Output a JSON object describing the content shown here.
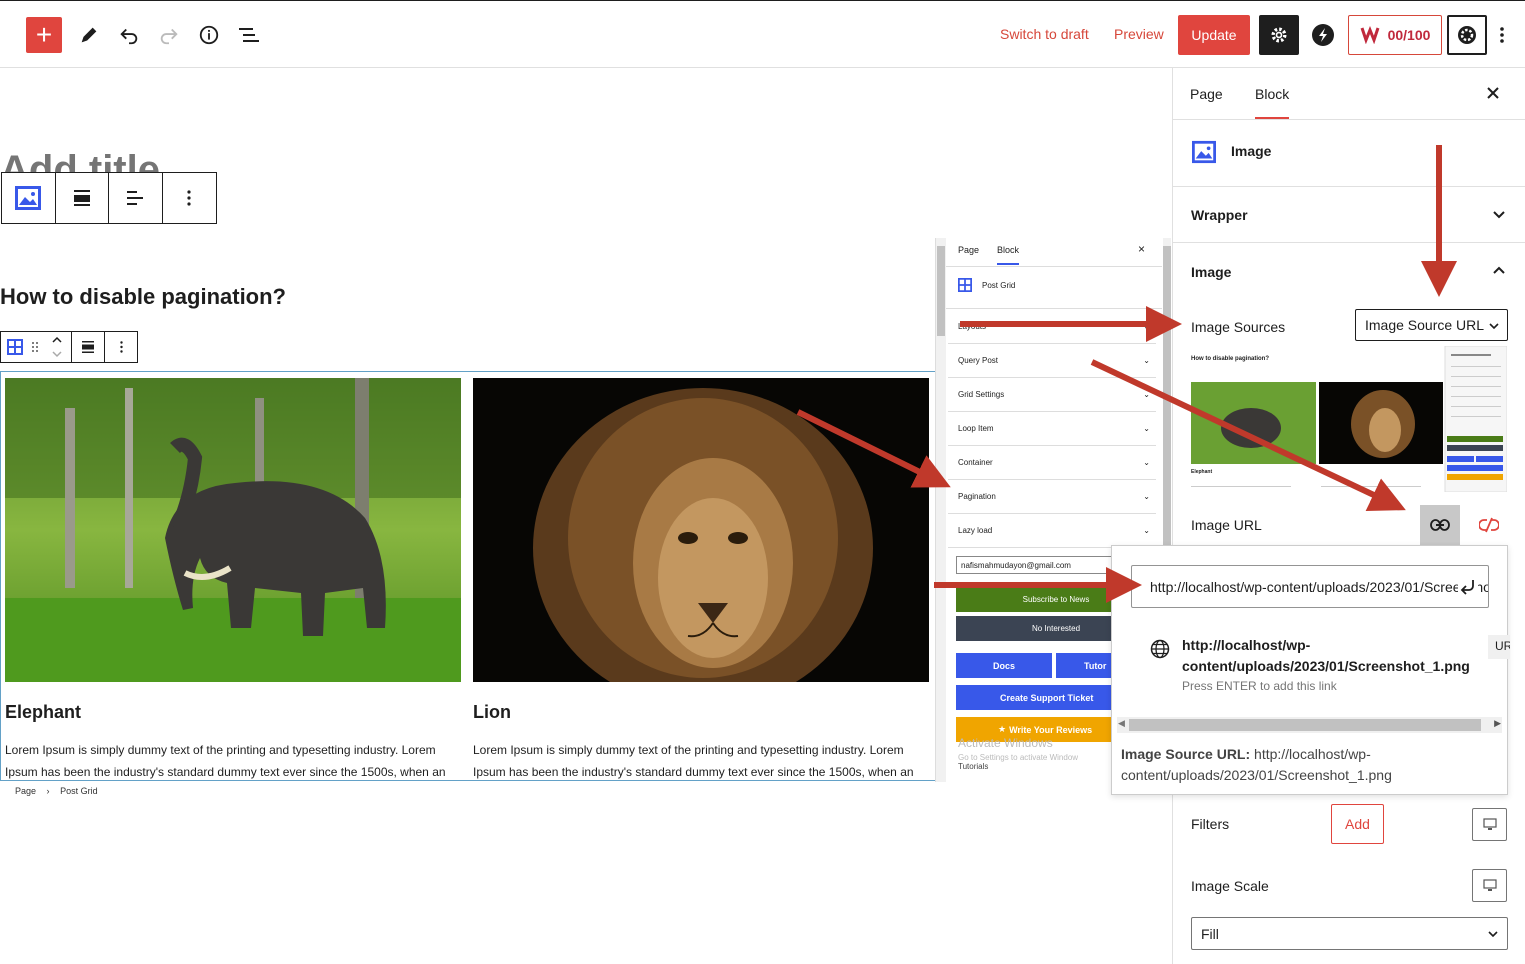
{
  "topbar": {
    "add_label": "+",
    "switch_draft": "Switch to draft",
    "preview": "Preview",
    "update": "Update",
    "score": "00/100"
  },
  "editor": {
    "title_placeholder": "Add title",
    "heading": "How to disable pagination?",
    "cards": [
      {
        "title": "Elephant",
        "text": "Lorem Ipsum is simply dummy text of the printing and typesetting industry. Lorem Ipsum has been the industry's standard dummy text ever since the 1500s, when an"
      },
      {
        "title": "Lion",
        "text": "Lorem Ipsum is simply dummy text of the printing and typesetting industry. Lorem Ipsum has been the industry's standard dummy text ever since the 1500s, when an"
      }
    ],
    "breadcrumb": {
      "page": "Page",
      "separator": "›",
      "current": "Post Grid"
    }
  },
  "embed": {
    "tabs": [
      "Page",
      "Block"
    ],
    "close": "×",
    "block_name": "Post Grid",
    "rows": [
      "Layouts",
      "Query Post",
      "Grid Settings",
      "Loop Item",
      "Container",
      "Pagination",
      "Lazy load"
    ],
    "email": "nafismahmudayon@gmail.com",
    "subscribe": "Subscribe to News",
    "no_interest": "No Interested",
    "docs": "Docs",
    "tutorials_btn": "Tutor",
    "support": "Create Support Ticket",
    "reviews": "Write Your Reviews",
    "watermark_title": "Activate Windows",
    "watermark_sub": "Go to Settings to activate Window",
    "tutorials": "Tutorials"
  },
  "sidebar": {
    "tabs": {
      "page": "Page",
      "block": "Block"
    },
    "close": "×",
    "block_name": "Image",
    "wrapper": "Wrapper",
    "image": "Image",
    "image_sources_label": "Image Sources",
    "image_sources_value": "Image Source URL",
    "image_url_label": "Image URL",
    "filters_label": "Filters",
    "filters_add": "Add",
    "image_scale_label": "Image Scale",
    "image_scale_value": "Fill"
  },
  "popover": {
    "url_value": "http://localhost/wp-content/uploads/2023/01/Screenshot_1.png",
    "suggest_url": "http://localhost/wp-content/uploads/2023/01/Screenshot_1.png",
    "suggest_type": "UR",
    "hint": "Press ENTER to add this link",
    "source_label": "Image Source URL:",
    "source_value": "http://localhost/wp-content/uploads/2023/01/Screenshot_1.png"
  },
  "thumb": {
    "heading": "How to disable pagination?",
    "card_title": "Elephant"
  },
  "colors": {
    "accent_red": "#e0453e",
    "arrow_red": "#c0392b",
    "wp_blue": "#3858e9",
    "green": "#4a7c17",
    "orange": "#f0a500",
    "slate": "#3b4453"
  }
}
